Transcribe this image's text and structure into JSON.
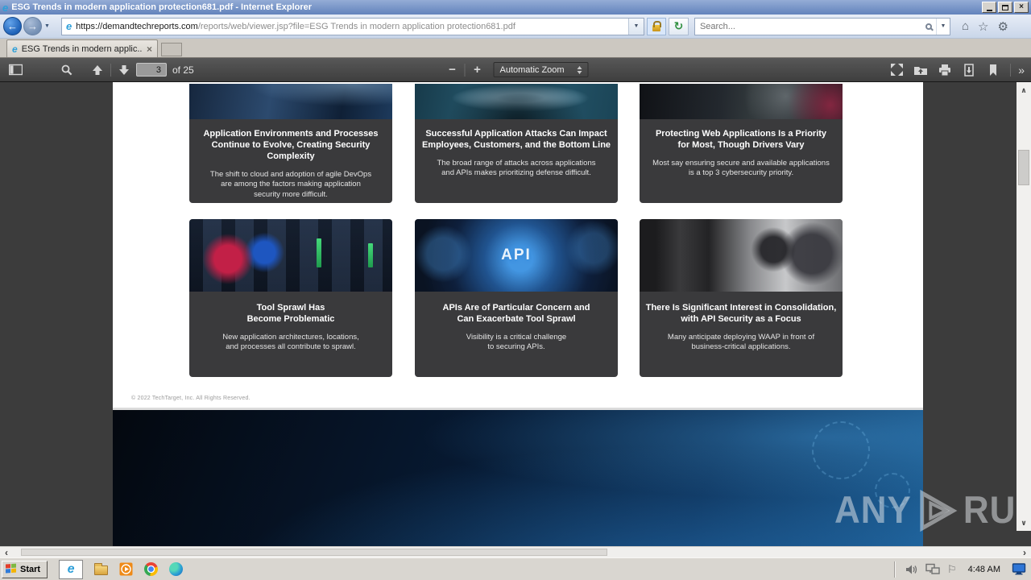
{
  "window": {
    "title": "ESG Trends in modern application protection681.pdf - Internet Explorer"
  },
  "icons": {
    "back": "←",
    "forward": "→",
    "dropdown": "▼",
    "refresh": "↻",
    "home": "⌂",
    "favorites": "☆",
    "tools": "⚙",
    "close": "×",
    "tab_close": "×",
    "chevron_double": "»",
    "zoom_out": "−",
    "zoom_in": "+",
    "scroll_up": "∧",
    "scroll_down": "∨",
    "scroll_left": "‹",
    "scroll_right": "›",
    "flag": "⚐"
  },
  "nav": {
    "url_host": "https://demandtechreports.com",
    "url_path": "/reports/web/viewer.jsp?file=ESG Trends in modern application protection681.pdf",
    "search_placeholder": "Search..."
  },
  "tabs": {
    "active_label": "ESG Trends in modern applic..."
  },
  "pdf_toolbar": {
    "page_number": "3",
    "page_count": "of 25",
    "zoom_select": "Automatic Zoom"
  },
  "document": {
    "cards": [
      {
        "title": "Application Environments and Processes\nContinue to Evolve, Creating Security Complexity",
        "body": "The shift to cloud and adoption of agile DevOps\nare among the factors making application\nsecurity more difficult."
      },
      {
        "title": "Successful Application Attacks Can Impact\nEmployees, Customers, and the Bottom Line",
        "body": "The broad range of attacks across applications\nand APIs makes prioritizing defense difficult."
      },
      {
        "title": "Protecting Web Applications Is a Priority\nfor Most, Though Drivers Vary",
        "body": "Most say ensuring secure and available applications\nis a top 3 cybersecurity priority."
      },
      {
        "title": "Tool Sprawl Has\nBecome Problematic",
        "body": "New application architectures, locations,\nand processes all contribute to sprawl."
      },
      {
        "title": "APIs Are of Particular Concern and\nCan Exacerbate Tool Sprawl",
        "body": "Visibility is a critical challenge\nto securing APIs.",
        "image_label": "API"
      },
      {
        "title": "There Is Significant Interest in Consolidation,\nwith API Security as a Focus",
        "body": "Many anticipate deploying WAAP in front of\nbusiness-critical applications."
      }
    ],
    "footer": "© 2022 TechTarget, Inc. All Rights Reserved."
  },
  "watermark": {
    "left": "ANY",
    "right": "RUN"
  },
  "taskbar": {
    "start": "Start",
    "clock": "4:48 AM"
  },
  "colors": {
    "titlebar_blue": "#6e8cc2",
    "toolbar_dark": "#474747",
    "viewer_bg": "#3c3c3c",
    "card_bg": "#3a3a3c",
    "taskbar_gray": "#d9d6d0",
    "ie_blue": "#2d9fd9"
  }
}
